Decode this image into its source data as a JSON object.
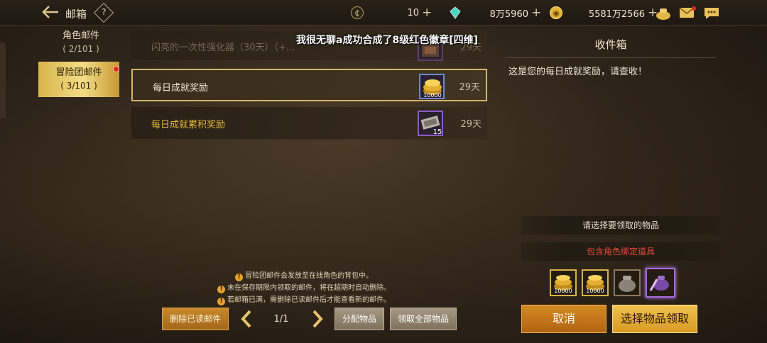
{
  "header": {
    "title": "邮箱",
    "help_label": "?",
    "currencies": [
      {
        "icon": "cera-coin-icon",
        "value": "10"
      },
      {
        "icon": "gem-icon",
        "value": "8万5960"
      },
      {
        "icon": "gold-coin-icon",
        "value": "5581万2566"
      }
    ]
  },
  "sidebar": {
    "tabs": [
      {
        "label": "角色邮件",
        "count": "( 2/101 )"
      },
      {
        "label": "冒险团邮件",
        "count": "( 3/101 )"
      }
    ]
  },
  "notice": "我很无聊a成功合成了8级红色徽章[四维]",
  "mails": [
    {
      "title": "闪亮的一次性强化器（30天）（+...",
      "days": "29天"
    },
    {
      "title": "每日成就奖励",
      "days": "29天",
      "item_count": "10000"
    },
    {
      "title": "每日成就累积奖励",
      "days": "29天",
      "item_count": "15"
    }
  ],
  "detail": {
    "title": "收件箱",
    "message": "这是您的每日成就奖励，请查收！",
    "select_hint": "请选择要领取的物品",
    "bound_hint": "包含角色绑定道具",
    "items": [
      {
        "icon": "gold-coins-icon",
        "count": "10000"
      },
      {
        "icon": "gold-coins-icon",
        "count": "10000"
      },
      {
        "icon": "pot-icon",
        "count": ""
      },
      {
        "icon": "teapot-icon",
        "count": ""
      }
    ]
  },
  "notes": [
    "冒险团邮件会发放至在线角色的背包中。",
    "未在保存期限内领取的邮件，将在超期时自动删除。",
    "若邮箱已满，需删除已读邮件后才能查看新的邮件。"
  ],
  "footer": {
    "delete_read": "删除已读邮件",
    "page": "1/1",
    "distribute": "分配物品",
    "claim_all": "领取全部物品",
    "cancel": "取消",
    "select_claim": "选择物品领取"
  }
}
